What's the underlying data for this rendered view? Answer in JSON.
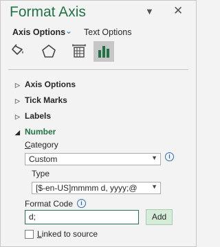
{
  "header": {
    "title": "Format Axis",
    "dropdown_icon": "chevron-down-icon",
    "close_icon": "close-icon"
  },
  "tabs": {
    "axis_options": "Axis Options",
    "text_options": "Text Options"
  },
  "icon_tabs": [
    "fill-line-icon",
    "effects-pentagon-icon",
    "size-properties-icon",
    "axis-options-bar-chart-icon"
  ],
  "sections": {
    "axis_options": "Axis Options",
    "tick_marks": "Tick Marks",
    "labels": "Labels",
    "number": "Number"
  },
  "number": {
    "category_label_pre": "",
    "category_label_acc": "C",
    "category_label_post": "ategory",
    "category_value": "Custom",
    "type_label": "Type",
    "type_value": "[$-en-US]mmmm d, yyyy;@",
    "format_code_label": "Format Code",
    "format_code_value": "d;",
    "add_label": "Add",
    "linked_label_acc": "L",
    "linked_label_post": "inked to source"
  },
  "colors": {
    "accent": "#217346",
    "info": "#2b6cb0"
  }
}
